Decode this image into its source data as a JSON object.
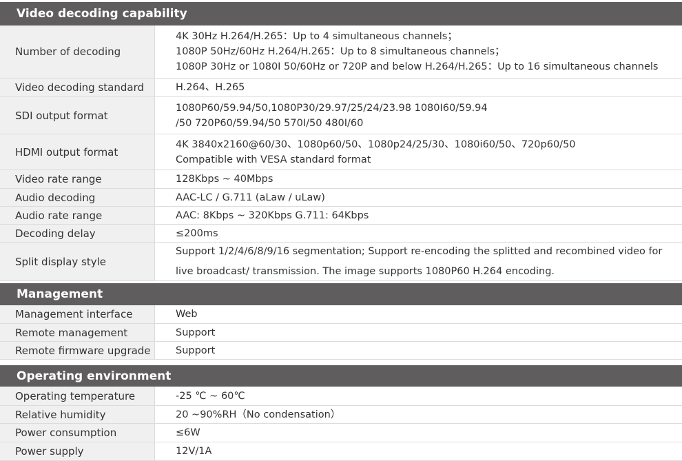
{
  "sections": [
    {
      "title": "Video decoding capability",
      "rows": [
        {
          "label": "Number of decoding",
          "lines": [
            "4K 30Hz H.264/H.265：Up to 4 simultaneous channels；",
            "1080P 50Hz/60Hz H.264/H.265：Up to 8 simultaneous channels；",
            "1080P 30Hz or 1080I 50/60Hz or 720P and below H.264/H.265：Up to 16 simultaneous channels"
          ]
        },
        {
          "label": "Video decoding standard",
          "lines": [
            "H.264、H.265"
          ]
        },
        {
          "label": "SDI output format",
          "lines": [
            "1080P60/59.94/50,1080P30/29.97/25/24/23.98 1080I60/59.94",
            "/50 720P60/59.94/50 570I/50 480I/60"
          ]
        },
        {
          "label": "HDMI output format",
          "lines": [
            "4K 3840x2160@60/30、1080p60/50、1080p24/25/30、1080i60/50、720p60/50",
            "Compatible with VESA standard format"
          ]
        },
        {
          "label": "Video rate range",
          "lines": [
            "128Kbps ~ 40Mbps"
          ]
        },
        {
          "label": "Audio decoding",
          "lines": [
            "AAC-LC / G.711 (aLaw / uLaw)"
          ]
        },
        {
          "label": "Audio rate range",
          "lines": [
            "AAC: 8Kbps ~ 320Kbps G.711: 64Kbps"
          ]
        },
        {
          "label": "Decoding delay",
          "lines": [
            "≤200ms"
          ]
        },
        {
          "label": "Split display style",
          "lines": [
            "Support 1/2/4/6/8/9/16 segmentation; Support re-encoding the splitted and recombined video for",
            "live broadcast/ transmission. The image supports 1080P60 H.264 encoding."
          ]
        }
      ]
    },
    {
      "title": "Management",
      "rows": [
        {
          "label": "Management interface",
          "lines": [
            "Web"
          ]
        },
        {
          "label": "Remote management",
          "lines": [
            "Support"
          ]
        },
        {
          "label": "Remote firmware upgrade",
          "lines": [
            "Support"
          ]
        }
      ]
    },
    {
      "title": "Operating environment",
      "rows": [
        {
          "label": "Operating temperature",
          "lines": [
            "-25 ℃ ~ 60℃"
          ]
        },
        {
          "label": "Relative humidity",
          "lines": [
            "20 ~90%RH（No condensation）"
          ]
        },
        {
          "label": "Power consumption",
          "lines": [
            "≤6W"
          ]
        },
        {
          "label": "Power supply",
          "lines": [
            "12V/1A"
          ]
        }
      ]
    }
  ]
}
